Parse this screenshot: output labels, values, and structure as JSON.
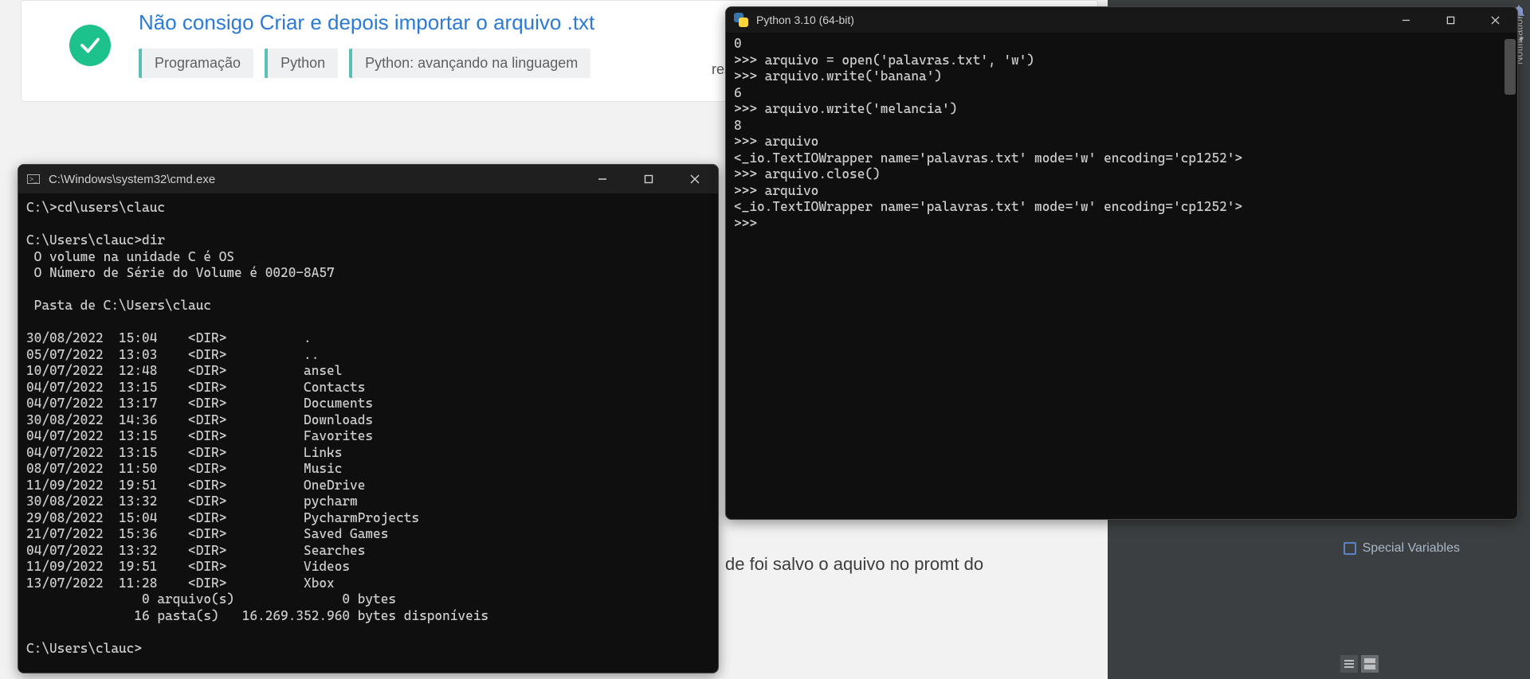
{
  "browser": {
    "title": "Não consigo Criar e depois importar o arquivo .txt",
    "tags": [
      "Programação",
      "Python",
      "Python: avançando na linguagem"
    ],
    "bg_text_fragment": "de foi salvo o aquivo no promt do",
    "res_fragment": "res"
  },
  "ide": {
    "notifications_label": "Notifications",
    "special_variables": "Special Variables"
  },
  "cmd": {
    "title": "C:\\Windows\\system32\\cmd.exe",
    "body": "C:\\>cd\\users\\clauc\n\nC:\\Users\\clauc>dir\n O volume na unidade C é OS\n O Número de Série do Volume é 0020-8A57\n\n Pasta de C:\\Users\\clauc\n\n30/08/2022  15:04    <DIR>          .\n05/07/2022  13:03    <DIR>          ..\n10/07/2022  12:48    <DIR>          ansel\n04/07/2022  13:15    <DIR>          Contacts\n04/07/2022  13:17    <DIR>          Documents\n30/08/2022  14:36    <DIR>          Downloads\n04/07/2022  13:15    <DIR>          Favorites\n04/07/2022  13:15    <DIR>          Links\n08/07/2022  11:50    <DIR>          Music\n11/09/2022  19:51    <DIR>          OneDrive\n30/08/2022  13:32    <DIR>          pycharm\n29/08/2022  15:04    <DIR>          PycharmProjects\n21/07/2022  15:36    <DIR>          Saved Games\n04/07/2022  13:32    <DIR>          Searches\n11/09/2022  19:51    <DIR>          Videos\n13/07/2022  11:28    <DIR>          Xbox\n               0 arquivo(s)              0 bytes\n              16 pasta(s)   16.269.352.960 bytes disponíveis\n\nC:\\Users\\clauc>"
  },
  "python": {
    "title": "Python 3.10 (64-bit)",
    "body": "0\n>>> arquivo = open('palavras.txt', 'w')\n>>> arquivo.write('banana')\n6\n>>> arquivo.write('melancia')\n8\n>>> arquivo\n<_io.TextIOWrapper name='palavras.txt' mode='w' encoding='cp1252'>\n>>> arquivo.close()\n>>> arquivo\n<_io.TextIOWrapper name='palavras.txt' mode='w' encoding='cp1252'>\n>>> "
  }
}
